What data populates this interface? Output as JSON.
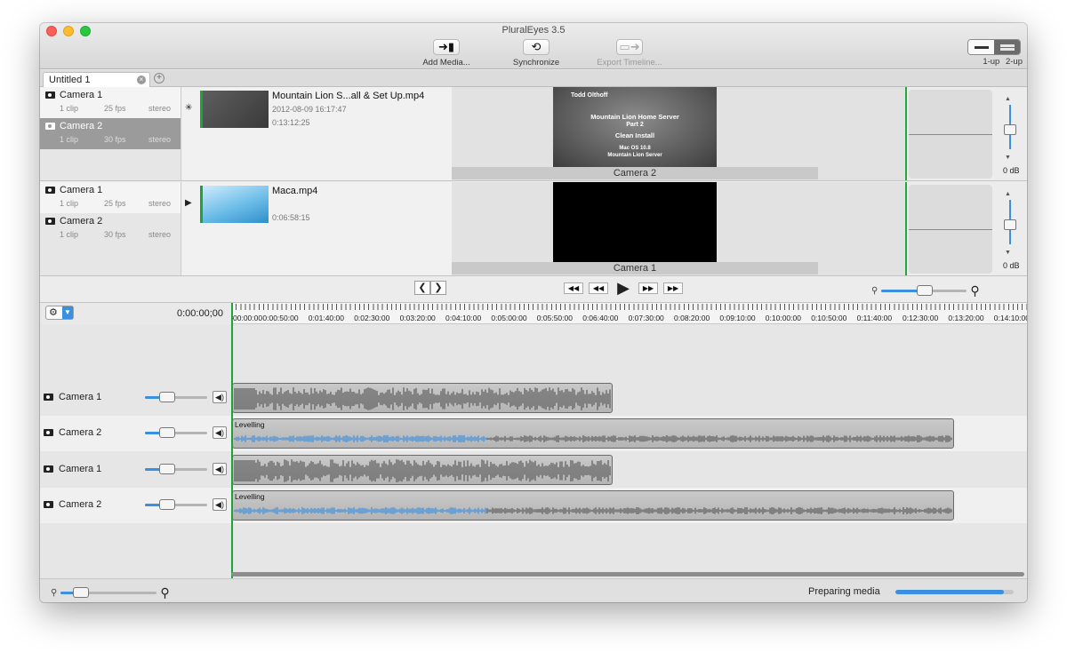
{
  "window": {
    "title": "PluralEyes 3.5"
  },
  "toolbar": {
    "add_media": {
      "label": "Add Media...",
      "icon": "add-media-icon"
    },
    "synchronize": {
      "label": "Synchronize",
      "icon": "sync-icon"
    },
    "export_timeline": {
      "label": "Export Timeline...",
      "icon": "export-icon",
      "enabled": false
    },
    "view_modes": {
      "one_up": "1-up",
      "two_up": "2-up",
      "selected": "2-up"
    }
  },
  "tabs": [
    {
      "label": "Untitled 1",
      "active": true
    }
  ],
  "media_groups": [
    {
      "cameras": [
        {
          "name": "Camera 1",
          "clips": "1 clip",
          "fps": "25 fps",
          "audio": "stereo",
          "selected": false
        },
        {
          "name": "Camera 2",
          "clips": "1 clip",
          "fps": "30 fps",
          "audio": "stereo",
          "selected": true
        }
      ],
      "clip": {
        "title": "Mountain Lion S...all & Set Up.mp4",
        "date": "2012-08-09 16:17:47",
        "duration": "0:13:12:25"
      },
      "preview": {
        "label": "Camera 2",
        "slide_lines": [
          "Todd Olthoff",
          "Mountain Lion Home Server",
          "Part 2",
          "Clean Install",
          "Mac OS 10.8",
          "Mountain Lion Server"
        ]
      },
      "volume": "0 dB"
    },
    {
      "cameras": [
        {
          "name": "Camera 1",
          "clips": "1 clip",
          "fps": "25 fps",
          "audio": "stereo",
          "selected": false
        },
        {
          "name": "Camera 2",
          "clips": "1 clip",
          "fps": "30 fps",
          "audio": "stereo",
          "selected": false
        }
      ],
      "clip": {
        "title": "Maca.mp4",
        "date": "",
        "duration": "0:06:58:15"
      },
      "preview": {
        "label": "Camera 1"
      },
      "volume": "0 dB"
    }
  ],
  "timeline": {
    "timecode": "0:00:00;00",
    "ruler_labels": [
      "00:00:00",
      "0:00:50:00",
      "0:01:40:00",
      "0:02:30:00",
      "0:03:20:00",
      "0:04:10:00",
      "0:05:00:00",
      "0:05:50:00",
      "0:06:40:00",
      "0:07:30:00",
      "0:08:20:00",
      "0:09:10:00",
      "0:10:00:00",
      "0:10:50:00",
      "0:11:40:00",
      "0:12:30:00",
      "0:13:20:00",
      "0:14:10:00"
    ],
    "tracks": [
      {
        "name": "Camera 1",
        "clip_label": "",
        "clip_end": 0.48,
        "levelling": false
      },
      {
        "name": "Camera 2",
        "clip_label": "Levelling",
        "clip_end": 0.91,
        "levelling": true
      },
      {
        "name": "Camera 1",
        "clip_label": "",
        "clip_end": 0.48,
        "levelling": false
      },
      {
        "name": "Camera 2",
        "clip_label": "Levelling",
        "clip_end": 0.91,
        "levelling": true
      }
    ]
  },
  "status": {
    "text": "Preparing media",
    "progress": 0.92
  },
  "colors": {
    "accent": "#3a8fe0",
    "sync_marker": "#1fa23a"
  }
}
